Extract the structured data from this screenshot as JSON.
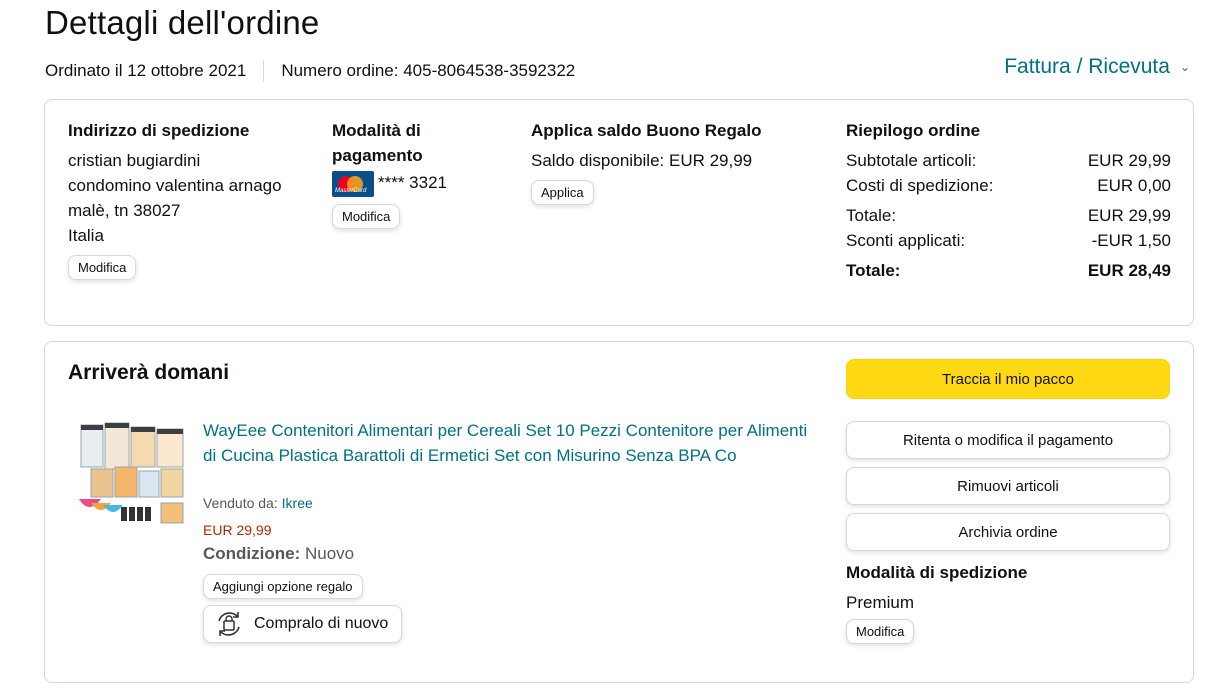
{
  "page": {
    "title": "Dettagli dell'ordine",
    "ordered_on": "Ordinato il 12 ottobre 2021",
    "order_number": "Numero ordine: 405-8064538-3592322",
    "invoice_link": "Fattura / Ricevuta",
    "invoice_chevron": "⌄"
  },
  "shipping_address": {
    "heading": "Indirizzo di spedizione",
    "lines": [
      "cristian bugiardini",
      "condomino valentina arnago",
      "malè, tn 38027",
      "Italia"
    ],
    "edit_label": "Modifica"
  },
  "payment": {
    "heading_line1": "Modalità di",
    "heading_line2": "pagamento",
    "card_icon": "mastercard-icon",
    "card_brand_text": "MasterCard",
    "card_digits": "**** 3321",
    "edit_label": "Modifica"
  },
  "gift_balance": {
    "heading": "Applica saldo Buono Regalo",
    "available": "Saldo disponibile: EUR 29,99",
    "apply_label": "Applica"
  },
  "summary": {
    "heading": "Riepilogo ordine",
    "rows": [
      {
        "label": "Subtotale articoli:",
        "value": "EUR 29,99"
      },
      {
        "label": "Costi di spedizione:",
        "value": "EUR 0,00"
      },
      {
        "label": "Totale:",
        "value": "EUR 29,99"
      },
      {
        "label": "Sconti applicati:",
        "value": "-EUR 1,50"
      }
    ],
    "grand_total_label": "Totale:",
    "grand_total_value": "EUR 28,49"
  },
  "shipment": {
    "status": "Arriverà domani",
    "product_title": "WayEee Contenitori Alimentari per Cereali Set 10 Pezzi Contenitore per Alimenti di Cucina Plastica Barattoli di Ermetici Set con Misurino Senza BPA Co",
    "sold_by_label": "Venduto da:",
    "seller": "Ikree",
    "price": "EUR 29,99",
    "condition_label": "Condizione:",
    "condition_value": "Nuovo",
    "gift_option_label": "Aggiungi opzione regalo",
    "buy_again_label": "Compralo di nuovo",
    "buy_again_icon": "buy-again-icon"
  },
  "actions": {
    "track": "Traccia il mio pacco",
    "retry_payment": "Ritenta o modifica il pagamento",
    "remove_items": "Rimuovi articoli",
    "archive": "Archivia ordine"
  },
  "shipping_method": {
    "heading": "Modalità di spedizione",
    "value": "Premium",
    "edit_label": "Modifica"
  },
  "colors": {
    "link": "#007185",
    "price": "#b12704",
    "primary_button": "#ffd814",
    "border": "#d5d9d9"
  }
}
